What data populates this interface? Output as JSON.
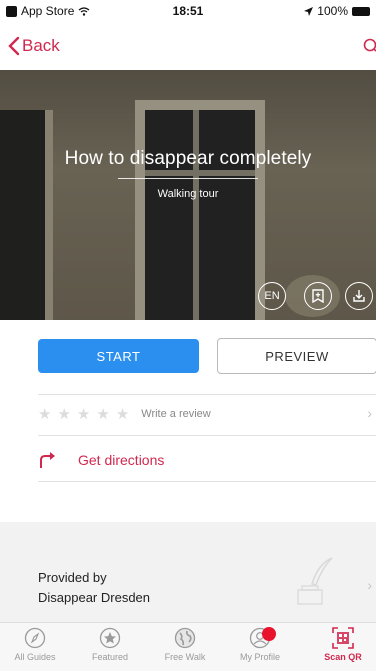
{
  "status_bar": {
    "carrier": "App Store",
    "time": "18:51",
    "battery": "100%"
  },
  "nav": {
    "back_label": "Back"
  },
  "hero": {
    "title": "How to disappear completely",
    "subtitle": "Walking tour",
    "language": "EN"
  },
  "actions": {
    "start_label": "START",
    "preview_label": "PREVIEW"
  },
  "review": {
    "label": "Write a review",
    "rating": 0,
    "max_rating": 5
  },
  "directions": {
    "label": "Get directions"
  },
  "provider": {
    "label": "Provided by",
    "name": "Disappear Dresden"
  },
  "tabs": [
    {
      "label": "All Guides",
      "icon": "compass-icon"
    },
    {
      "label": "Featured",
      "icon": "star-icon"
    },
    {
      "label": "Free Walk",
      "icon": "globe-icon"
    },
    {
      "label": "My Profile",
      "icon": "profile-icon"
    },
    {
      "label": "Scan QR",
      "icon": "qr-icon"
    }
  ],
  "colors": {
    "accent": "#d0284f",
    "primary_button": "#2b8ff0",
    "badge": "#e8122c"
  }
}
